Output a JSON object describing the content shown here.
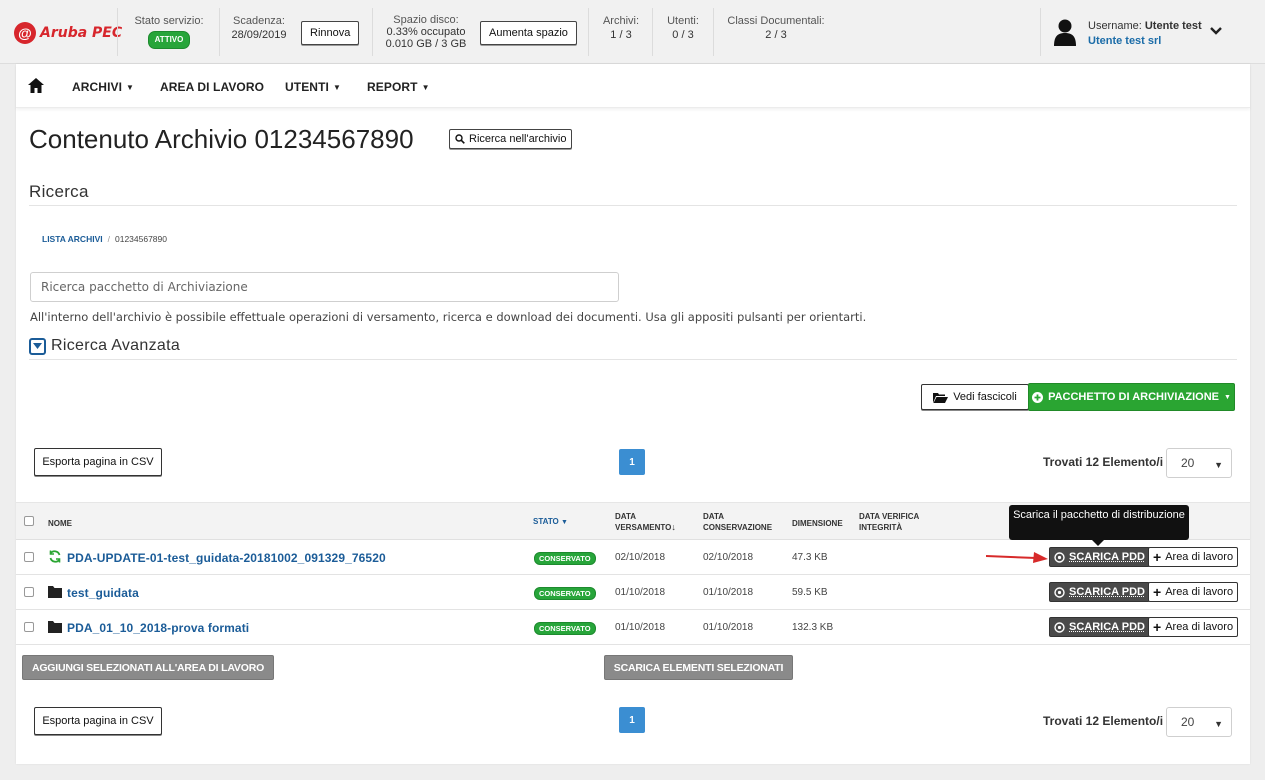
{
  "brand": {
    "mark": "@",
    "name": "Aruba PEC"
  },
  "topbar": {
    "service_label": "Stato servizio:",
    "service_status": "ATTIVO",
    "expiry_label": "Scadenza:",
    "expiry_value": "28/09/2019",
    "renew_button": "Rinnova",
    "disk_label": "Spazio disco:",
    "disk_used_pct": "0.33% occupato",
    "disk_used": "0.010 GB / 3 GB",
    "disk_button": "Aumenta spazio",
    "archives_label": "Archivi:",
    "archives_value": "1 / 3",
    "users_label": "Utenti:",
    "users_value": "0 / 3",
    "classes_label": "Classi Documentali:",
    "classes_value": "2 / 3",
    "username_label": "Username:",
    "username_value": "Utente test",
    "company": "Utente test srl"
  },
  "nav": {
    "items": [
      {
        "label": "ARCHIVI",
        "dropdown": true
      },
      {
        "label": "AREA DI LAVORO",
        "dropdown": false
      },
      {
        "label": "UTENTI",
        "dropdown": true
      },
      {
        "label": "REPORT",
        "dropdown": true
      }
    ],
    "caret": "▼"
  },
  "page": {
    "title": "Contenuto Archivio 01234567890",
    "search_in_archive_button": "Ricerca nell'archivio",
    "section_title": "Ricerca",
    "breadcrumb": {
      "root": "LISTA ARCHIVI",
      "separator": "/",
      "current": "01234567890"
    },
    "search_placeholder": "Ricerca pacchetto di Archiviazione",
    "help_text": "All'interno dell'archivio è possibile effettuale operazioni di versamento, ricerca e download dei documenti. Usa gli appositi pulsanti per orientarti.",
    "advanced_title": "Ricerca Avanzata",
    "view_folders_button": "Vedi fascicoli",
    "archive_package_button": "PACCHETTO DI ARCHIVIAZIONE",
    "export_csv_button": "Esporta pagina in CSV",
    "current_page": "1",
    "found_text": "Trovati 12 Elemento/i",
    "page_size": "20"
  },
  "table": {
    "headers": {
      "name": "NOME",
      "status": "STATO",
      "date_deposit_1": "DATA",
      "date_deposit_2": "VERSAMENTO",
      "date_conservation_1": "DATA",
      "date_conservation_2": "CONSERVAZIONE",
      "size": "DIMENSIONE",
      "integrity_1": "DATA VERIFICA",
      "integrity_2": "INTEGRITÀ"
    },
    "rows": [
      {
        "icon": "refresh-icon",
        "name": "PDA-UPDATE-01-test_guidata-20181002_091329_76520",
        "status": "CONSERVATO",
        "deposit": "02/10/2018",
        "conservation": "02/10/2018",
        "size": "47.3 KB"
      },
      {
        "icon": "folder-icon",
        "name": "test_guidata",
        "status": "CONSERVATO",
        "deposit": "01/10/2018",
        "conservation": "01/10/2018",
        "size": "59.5 KB"
      },
      {
        "icon": "folder-icon",
        "name": "PDA_01_10_2018-prova formati",
        "status": "CONSERVATO",
        "deposit": "01/10/2018",
        "conservation": "01/10/2018",
        "size": "132.3 KB"
      }
    ],
    "download_pdd_label": "SCARICA PDD",
    "add_workspace_label": "Area di lavoro",
    "tooltip": "Scarica il pacchetto di distribuzione",
    "add_selected_button": "AGGIUNGI SELEZIONATI ALL'AREA DI LAVORO",
    "download_selected_button": "SCARICA ELEMENTI SELEZIONATI"
  },
  "colors": {
    "brand_red": "#d7262c",
    "green": "#2aa532",
    "link_blue": "#1b5c98",
    "page_blue": "#3b8ed2"
  }
}
